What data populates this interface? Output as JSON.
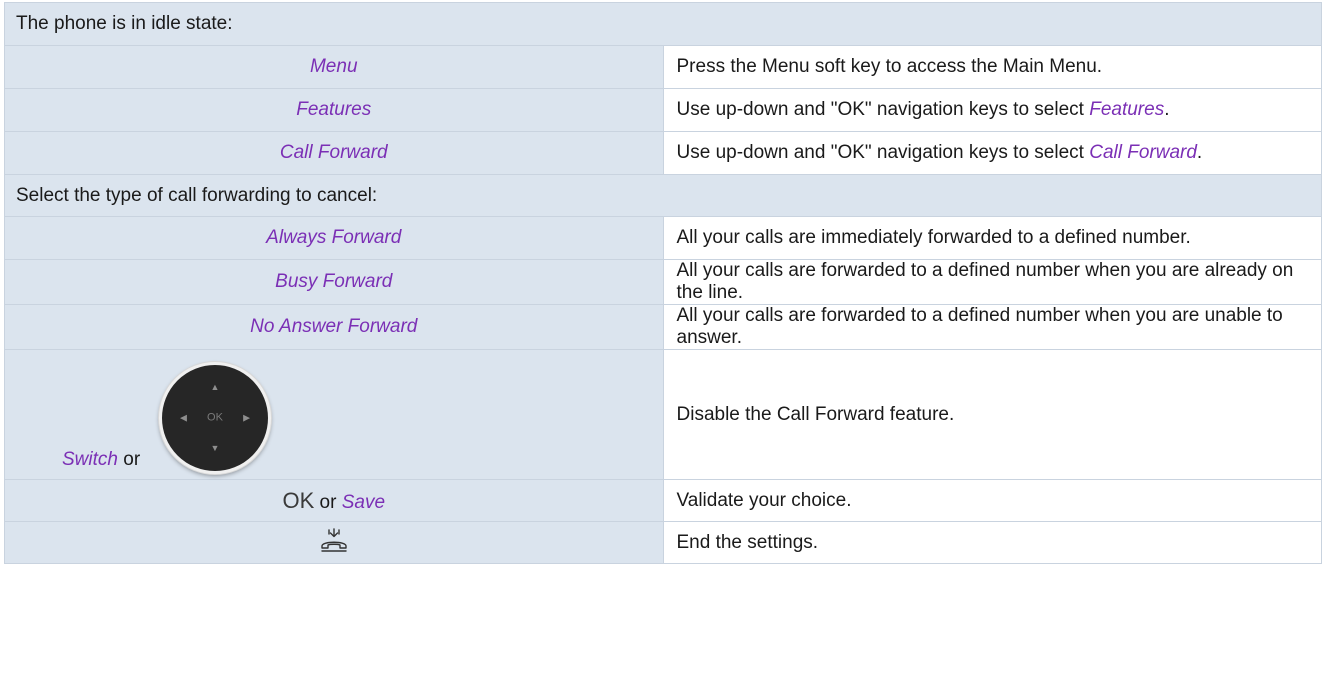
{
  "section1": {
    "heading": "The phone is in idle state:",
    "rows": [
      {
        "key": "Menu",
        "desc": "Press the Menu soft key to access the Main Menu."
      },
      {
        "key": "Features",
        "desc_before": "Use up-down and \"OK\" navigation keys to select ",
        "desc_em": "Features",
        "desc_after": "."
      },
      {
        "key": "Call Forward",
        "desc_before": "Use up-down and \"OK\" navigation keys to select ",
        "desc_em": "Call Forward",
        "desc_after": "."
      }
    ]
  },
  "section2": {
    "heading": "Select the type of call forwarding to cancel:",
    "rows": [
      {
        "key": "Always Forward",
        "desc": "All your calls are immediately forwarded to a defined number."
      },
      {
        "key": "Busy Forward",
        "desc": "All your calls are forwarded to a defined number when you are already on the line."
      },
      {
        "key": "No Answer Forward",
        "desc": "All your calls are forwarded to a defined number when you are unable to answer."
      }
    ],
    "switch_row": {
      "key_em": "Switch",
      "key_or": " or",
      "navpad": {
        "center": "OK",
        "up": "▲",
        "down": "▼",
        "left": "◀",
        "right": "▶",
        "icon": "navigation-pad-icon"
      },
      "desc": "Disable the Call Forward feature."
    },
    "ok_row": {
      "key_ok": "OK",
      "key_or": " or ",
      "key_em": "Save",
      "desc": "Validate your choice."
    },
    "end_row": {
      "icon": "hang-up-icon",
      "desc": "End the settings."
    }
  },
  "colors": {
    "label_purple": "#7b2fb5",
    "header_bg": "#dbe4ee",
    "key_bg": "#dbe4ee",
    "border": "#c9d3df"
  }
}
